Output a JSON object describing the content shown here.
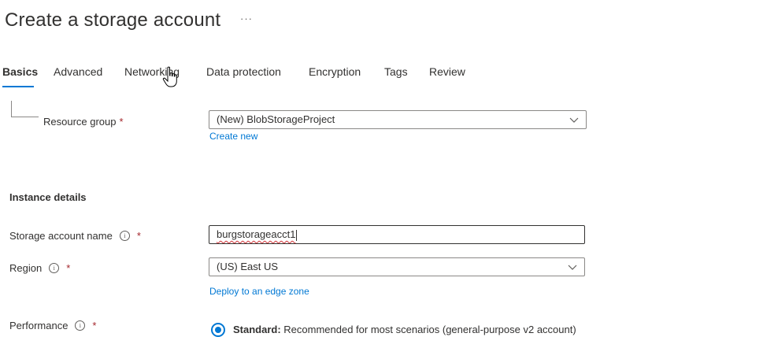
{
  "page": {
    "title": "Create a storage account",
    "more_label": "···"
  },
  "tabs": [
    {
      "label": "Basics",
      "active": true
    },
    {
      "label": "Advanced"
    },
    {
      "label": "Networking"
    },
    {
      "label": "Data protection"
    },
    {
      "label": "Encryption"
    },
    {
      "label": "Tags"
    },
    {
      "label": "Review"
    }
  ],
  "resource_group": {
    "label": "Resource group",
    "required_mark": "*",
    "value": "(New) BlobStorageProject",
    "create_new_link": "Create new"
  },
  "instance_details": {
    "heading": "Instance details",
    "storage_account_name": {
      "label": "Storage account name",
      "required_mark": "*",
      "value": "burgstorageacct1"
    },
    "region": {
      "label": "Region",
      "required_mark": "*",
      "value": "(US) East US",
      "edge_zone_link": "Deploy to an edge zone"
    },
    "performance": {
      "label": "Performance",
      "required_mark": "*",
      "option_title": "Standard:",
      "option_desc": " Recommended for most scenarios (general-purpose v2 account)"
    }
  },
  "info_glyph": "i",
  "colors": {
    "accent": "#0078d4",
    "required": "#a4262c",
    "text": "#323130",
    "border": "#8a8886"
  }
}
